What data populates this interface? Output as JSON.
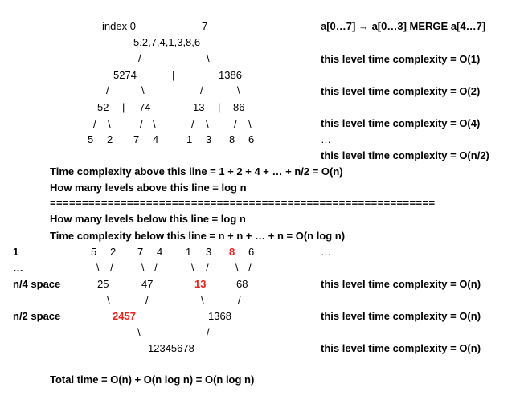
{
  "header": {
    "index_label": "index 0",
    "index_end": "7",
    "merge_desc": "a[0…7] → a[0…3] MERGE a[4…7]"
  },
  "top_tree": {
    "root": "5,2,7,4,1,3,8,6",
    "root_slash_left": "/",
    "root_slash_right": "\\",
    "left": "5274",
    "divider": "|",
    "right": "1386",
    "l2_slashes": [
      "/",
      "\\",
      "/",
      "\\"
    ],
    "l2": [
      "52",
      "|",
      "74",
      "13",
      "|",
      "86"
    ],
    "l3_slashes": [
      "/",
      "\\",
      "/",
      "\\",
      "/",
      "\\",
      "/",
      "\\"
    ],
    "leaves": [
      "5",
      "2",
      "7",
      "4",
      "1",
      "3",
      "8",
      "6"
    ]
  },
  "right_notes": {
    "level1": "this level time complexity = O(1)",
    "level2": "this level time complexity = O(2)",
    "level3": "this level time complexity = O(4)",
    "ellipsis": "…",
    "level_last": "this level time complexity = O(n/2)"
  },
  "middle": {
    "above_time": "Time complexity above this line = 1 + 2 + 4 + … + n/2 = O(n)",
    "above_levels": "How many levels above this line = log n",
    "separator": "============================================================",
    "below_levels": "How many levels below this line = log n",
    "below_time": "Time complexity below this line = n + n + … + n = O(n log n)"
  },
  "bottom_tree": {
    "row_label_1": "1",
    "row_label_2": "…",
    "row_label_3": "n/4 space",
    "row_label_4": "n/2 space",
    "leaves": [
      "5",
      "2",
      "7",
      "4",
      "1",
      "3",
      "8",
      "6"
    ],
    "leaves_ellipsis": "…",
    "b2_slashes": [
      "\\",
      "/",
      "\\",
      "/",
      "\\",
      "/",
      "\\",
      "/"
    ],
    "pairs": [
      "25",
      "47",
      "13",
      "68"
    ],
    "b3_slashes": [
      "\\",
      "/",
      "\\",
      "/"
    ],
    "merged": [
      "2457",
      "1368"
    ],
    "b4_slashes": [
      "\\",
      "/"
    ],
    "final": "12345678",
    "note1": "this level time complexity = O(n)",
    "note2": "this level time complexity = O(n)",
    "note3": "this level time complexity = O(n)"
  },
  "total": "Total time = O(n) + O(n log n) = O(n log n)",
  "colors": {
    "highlight": "#e8221c"
  }
}
